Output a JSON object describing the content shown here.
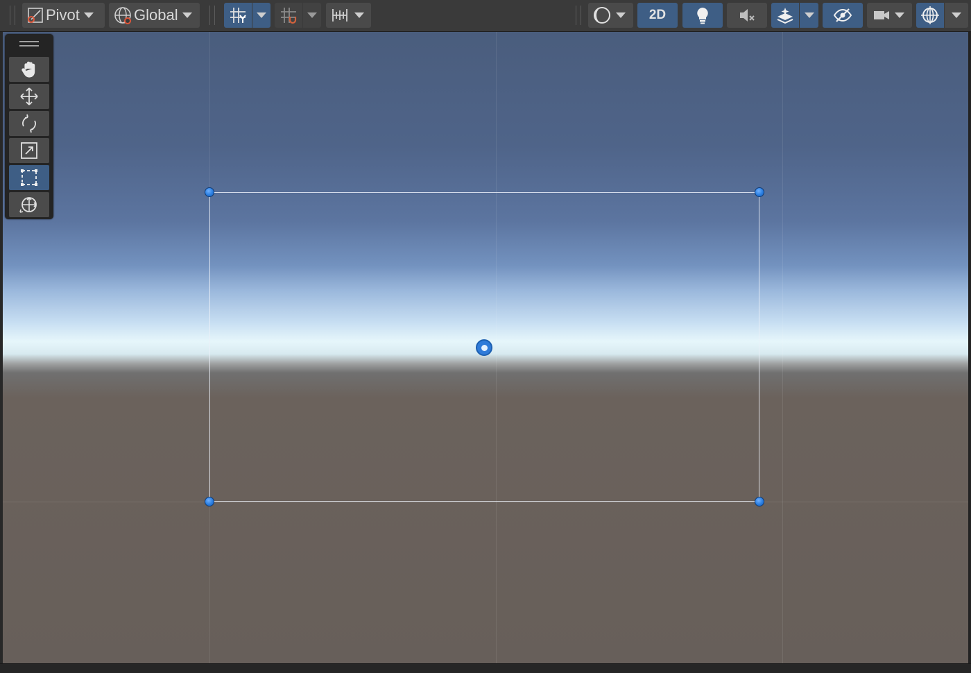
{
  "toolbar": {
    "pivot_label": "Pivot",
    "global_label": "Global",
    "mode_2d_label": "2D",
    "buttons": {
      "grid_snapping": "grid-snapping",
      "increment_snap": "increment-snap",
      "snap_settings": "snap-settings",
      "draw_mode": "draw-mode",
      "lighting": "lighting",
      "audio": "audio-mute",
      "effects": "effects",
      "hidden_objects": "scene-visibility",
      "camera": "camera",
      "gizmos": "gizmos"
    }
  },
  "tools": {
    "items": [
      {
        "name": "view-tool",
        "icon": "hand-icon",
        "active": false
      },
      {
        "name": "move-tool",
        "icon": "move-arrows-icon",
        "active": false
      },
      {
        "name": "rotate-tool",
        "icon": "rotate-icon",
        "active": false
      },
      {
        "name": "scale-tool",
        "icon": "scale-icon",
        "active": false
      },
      {
        "name": "rect-tool",
        "icon": "rect-transform-icon",
        "active": true
      },
      {
        "name": "transform-tool",
        "icon": "transform-icon",
        "active": false
      }
    ]
  },
  "colors": {
    "toolbar_bg": "#3a3a3a",
    "button_bg": "#4a4a4a",
    "active_blue": "#3e5e85",
    "handle_blue": "#2a7ee0",
    "sky_top": "#4a5d7d",
    "horizon": "#e6f6fb",
    "ground": "#675f5a"
  }
}
